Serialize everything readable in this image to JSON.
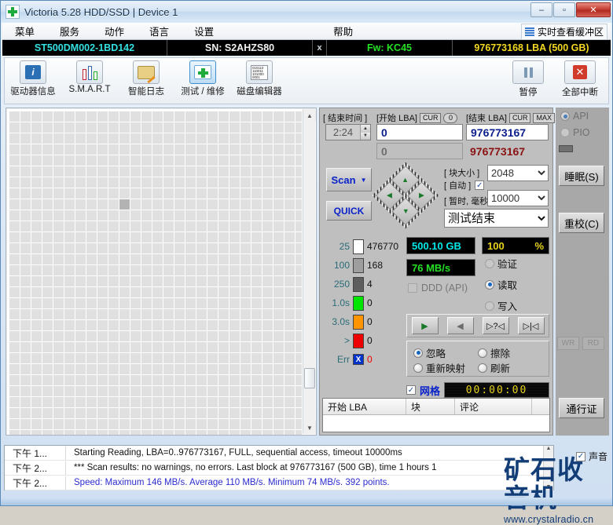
{
  "window": {
    "title": "Victoria 5.28 HDD/SSD | Device 1",
    "app_icon": "green-cross-icon",
    "minimize": "–",
    "maximize": "▫",
    "close": "✕"
  },
  "menubar": {
    "items": [
      {
        "label": "菜单"
      },
      {
        "label": "服务"
      },
      {
        "label": "动作"
      },
      {
        "label": "语言"
      },
      {
        "label": "设置"
      },
      {
        "label": "帮助"
      }
    ],
    "realtime_buffer": "实时查看缓冲区"
  },
  "device_bar": {
    "model": "ST500DM002-1BD142",
    "serial": "SN: S2AHZS80",
    "x": "x",
    "firmware": "Fw: KC45",
    "capacity": "976773168 LBA (500 GB)",
    "color_model": "#34e0e0",
    "color_serial": "#f2f2f2",
    "color_fw": "#25e025",
    "color_capacity": "#f2d820"
  },
  "toolbar": {
    "tabs": [
      {
        "label": "驱动器信息",
        "icon": "info-icon",
        "active": false
      },
      {
        "label": "S.M.A.R.T",
        "icon": "test-tubes-icon",
        "active": false
      },
      {
        "label": "智能日志",
        "icon": "folder-pencil-icon",
        "active": false
      },
      {
        "label": "测试 / 维修",
        "icon": "first-aid-icon",
        "active": true
      },
      {
        "label": "磁盘编辑器",
        "icon": "hex-editor-icon",
        "active": false
      }
    ],
    "pause_label": "暂停",
    "pause_icon": "pause-icon",
    "abort_label": "全部中断",
    "abort_icon": "red-x-icon"
  },
  "scan_controls": {
    "end_time_label": "[ 结束时间 ]",
    "end_time_value": "2:24",
    "start_lba_label": "[开始 LBA]",
    "start_lba_cur": "CUR",
    "start_lba_zero": "0",
    "start_lba_value": "0",
    "start_lba_value2": "0",
    "end_lba_label": "[结束 LBA]",
    "end_lba_cur": "CUR",
    "end_lba_max": "MAX",
    "end_lba_value": "976773167",
    "end_lba_value2": "976773167",
    "scan_button": "Scan",
    "scan_caret": "▼",
    "quick_button": "QUICK",
    "dpad": {
      "up": "▲",
      "down": "▼",
      "left": "◀",
      "right": "▶"
    },
    "block_size_label": "[ 块大小 ]",
    "block_size_value": "2048",
    "auto_label": "[ 自动 ]",
    "auto_checked": true,
    "timeout_label": "[ 暂时, 毫秒]",
    "timeout_value": "10000",
    "status_select": "测试结束"
  },
  "stats": {
    "rows": [
      {
        "threshold": "25",
        "color": "#ffffff",
        "count": "476770",
        "count_color": "#111111"
      },
      {
        "threshold": "100",
        "color": "#9e9e9e",
        "count": "168",
        "count_color": "#111111"
      },
      {
        "threshold": "250",
        "color": "#5e5e5e",
        "count": "4",
        "count_color": "#111111"
      },
      {
        "threshold": "1.0s",
        "color": "#00e500",
        "count": "0",
        "count_color": "#111111"
      },
      {
        "threshold": "3.0s",
        "color": "#ff9300",
        "count": "0",
        "count_color": "#111111"
      },
      {
        "threshold": ">",
        "color": "#ee0000",
        "count": "0",
        "count_color": "#111111"
      },
      {
        "threshold": "Err",
        "color": "#0033cc",
        "count": "0",
        "count_color": "#ee0000",
        "glyph": "X"
      }
    ]
  },
  "readout": {
    "capacity": "500.10 GB",
    "capacity_color": "#00e8e8",
    "percent_value": "100",
    "percent_sign": "%",
    "percent_color": "#e8d21a",
    "speed": "76 MB/s",
    "speed_color": "#25e025",
    "ddd_label": "DDD (API)",
    "ddd_checked": false,
    "modes": [
      {
        "label": "验证",
        "selected": false,
        "disabled": true
      },
      {
        "label": "读取",
        "selected": true,
        "disabled": false
      },
      {
        "label": "写入",
        "selected": false,
        "disabled": true
      }
    ]
  },
  "transport": {
    "buttons": [
      {
        "name": "play-forward",
        "glyph": "▶"
      },
      {
        "name": "play-reverse",
        "glyph": "◀"
      },
      {
        "name": "random-seek",
        "glyph": "▷?◁"
      },
      {
        "name": "seek-end",
        "glyph": "▷|◁"
      }
    ]
  },
  "defect_actions": {
    "options": [
      {
        "label": "忽略",
        "selected": true
      },
      {
        "label": "擦除",
        "selected": false
      },
      {
        "label": "重新映射",
        "selected": false
      },
      {
        "label": "刷新",
        "selected": false
      }
    ]
  },
  "grid_toggle": {
    "label": "网格",
    "checked": true,
    "timer": "00:00:00"
  },
  "results_table": {
    "columns": [
      "开始 LBA",
      "块",
      "评论"
    ]
  },
  "sidebar": {
    "api_label": "API",
    "api_selected": true,
    "pio_label": "PIO",
    "pio_selected": false,
    "sleep_button": "睡眠(S)",
    "recal_button": "重校(C)",
    "wr_button": "WR",
    "rd_button": "RD",
    "pass_button": "通行证"
  },
  "log": {
    "rows": [
      {
        "time": "下午 1...",
        "text": "Starting Reading, LBA=0..976773167, FULL, sequential access, timeout 10000ms",
        "color": "#111111"
      },
      {
        "time": "下午 2...",
        "text": "*** Scan results: no warnings, no errors. Last block at 976773167 (500 GB), time 1 hours 1",
        "color": "#111111"
      },
      {
        "time": "下午 2...",
        "text": "Speed: Maximum 146 MB/s. Average 110 MB/s. Minimum 74 MB/s. 392 points.",
        "color": "#2b2bd0"
      }
    ]
  },
  "sound": {
    "label": "声音",
    "checked": true
  },
  "watermark": {
    "text": "矿石收音机",
    "url": "www.crystalradio.cn"
  },
  "blockmap": {
    "columns": 27,
    "rows": 31,
    "last_row_cells": 11,
    "highlight_index": 226
  }
}
